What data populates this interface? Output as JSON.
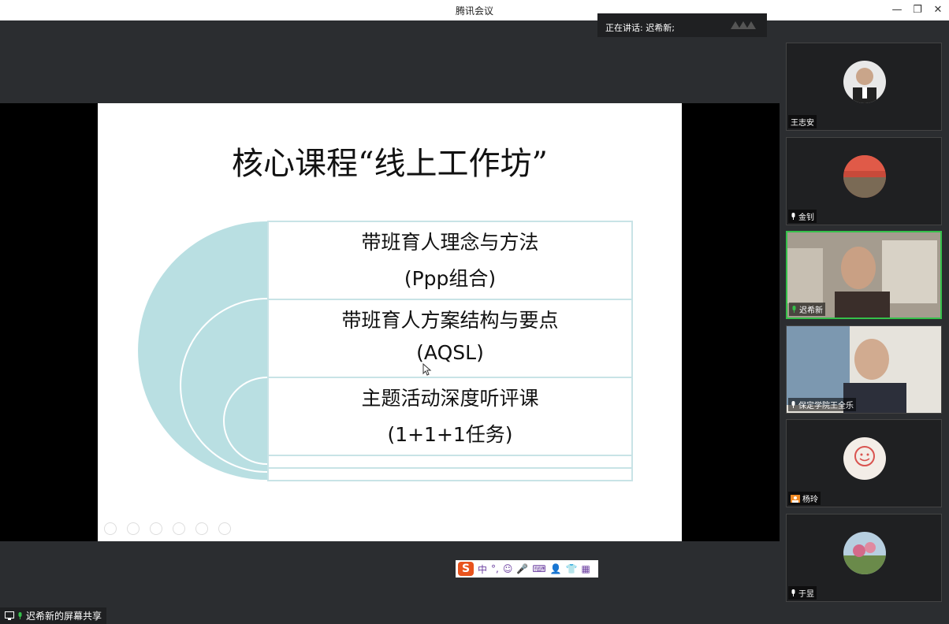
{
  "window": {
    "title": "腾讯会议",
    "minimize_glyph": "—",
    "restore_glyph": "❐",
    "close_glyph": "✕"
  },
  "speaking_banner": {
    "text": "正在讲话: 迟希新;"
  },
  "slide": {
    "title": "核心课程“线上工作坊”",
    "items": [
      {
        "line1": "带班育人理念与方法",
        "line2": "(Ppp组合)"
      },
      {
        "line1": "带班育人方案结构与要点",
        "line2": "(AQSL)"
      },
      {
        "line1": "主题活动深度听评课",
        "line2": "(1+1+1任务)"
      }
    ],
    "colors": {
      "arc_fill": "#b9dfe2",
      "box_border": "#c8e3e6"
    }
  },
  "ime_toolbar": {
    "logo": "S",
    "items": [
      "中",
      "°,",
      "☺",
      "🎤",
      "⌨",
      "👤",
      "👕",
      "▦"
    ]
  },
  "screen_share": {
    "label": "迟希新的屏幕共享"
  },
  "participants": [
    {
      "name": "王志安",
      "mic": false
    },
    {
      "name": "金钊",
      "mic": true
    },
    {
      "name": "迟希新",
      "mic": true,
      "active": true
    },
    {
      "name": "保定学院王全乐",
      "mic": true
    },
    {
      "name": "杨玲",
      "mic": false
    },
    {
      "name": "于昱",
      "mic": true
    }
  ],
  "colors": {
    "active_speaker_border": "#35c04a",
    "mic_green": "#35c04a",
    "background": "#2b2d30"
  }
}
